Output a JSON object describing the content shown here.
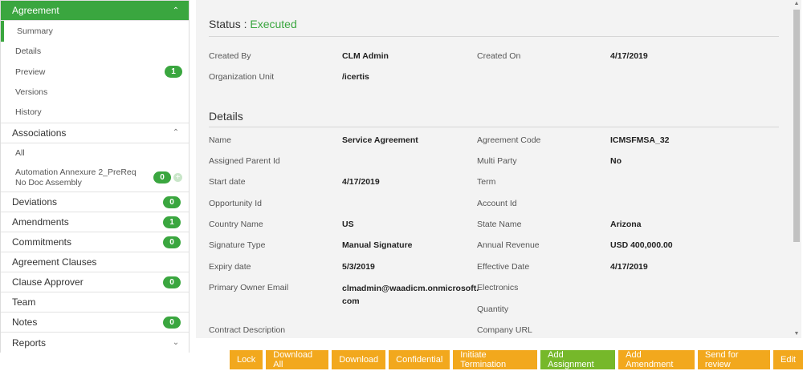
{
  "sidebar": {
    "agreement": {
      "title": "Agreement",
      "items": [
        {
          "label": "Summary"
        },
        {
          "label": "Details"
        },
        {
          "label": "Preview",
          "badge": "1"
        },
        {
          "label": "Versions"
        },
        {
          "label": "History"
        }
      ]
    },
    "associations": {
      "title": "Associations",
      "items": [
        {
          "label": "All"
        },
        {
          "label": "Automation Annexure 2_PreReq No Doc Assembly",
          "badge": "0"
        }
      ]
    },
    "sections": [
      {
        "label": "Deviations",
        "badge": "0"
      },
      {
        "label": "Amendments",
        "badge": "1"
      },
      {
        "label": "Commitments",
        "badge": "0"
      },
      {
        "label": "Agreement Clauses"
      },
      {
        "label": "Clause Approver",
        "badge": "0"
      },
      {
        "label": "Team"
      },
      {
        "label": "Notes",
        "badge": "0"
      },
      {
        "label": "Reports"
      }
    ]
  },
  "main": {
    "status_label": "Status :",
    "status_value": "Executed",
    "top_fields": {
      "created_by_label": "Created By",
      "created_by_value": "CLM Admin",
      "created_on_label": "Created On",
      "created_on_value": "4/17/2019",
      "org_unit_label": "Organization Unit",
      "org_unit_value": "/icertis"
    },
    "details_title": "Details",
    "details": {
      "name_label": "Name",
      "name_value": "Service Agreement",
      "agreement_code_label": "Agreement Code",
      "agreement_code_value": "ICMSFMSA_32",
      "assigned_parent_label": "Assigned Parent Id",
      "multi_party_label": "Multi Party",
      "multi_party_value": "No",
      "start_date_label": "Start date",
      "start_date_value": "4/17/2019",
      "term_label": "Term",
      "opportunity_label": "Opportunity Id",
      "account_label": "Account Id",
      "country_label": "Country Name",
      "country_value": "US",
      "state_label": "State Name",
      "state_value": "Arizona",
      "signature_label": "Signature Type",
      "signature_value": "Manual Signature",
      "revenue_label": "Annual Revenue",
      "revenue_value": "USD 400,000.00",
      "expiry_label": "Expiry date",
      "expiry_value": "5/3/2019",
      "effective_label": "Effective Date",
      "effective_value": "4/17/2019",
      "owner_email_label": "Primary Owner Email",
      "owner_email_value": "clmadmin@waadicm.onmicrosoft.com",
      "electronics_label": "Electronics",
      "quantity_label": "Quantity",
      "contract_desc_label": "Contract Description",
      "company_url_label": "Company URL"
    }
  },
  "buttons": [
    {
      "label": "Lock",
      "color": "#f2a81d"
    },
    {
      "label": "Download All",
      "color": "#f2a81d"
    },
    {
      "label": "Download",
      "color": "#f2a81d"
    },
    {
      "label": "Confidential",
      "color": "#f2a81d"
    },
    {
      "label": "Initiate Termination",
      "color": "#f2a81d"
    },
    {
      "label": "Add Assignment",
      "color": "#76b82a"
    },
    {
      "label": "Add Amendment",
      "color": "#f2a81d"
    },
    {
      "label": "Send for review",
      "color": "#f2a81d"
    },
    {
      "label": "Edit",
      "color": "#f2a81d"
    }
  ],
  "colors": {
    "accent_green": "#3aa63f",
    "button_orange": "#f2a81d",
    "button_green": "#76b82a"
  }
}
